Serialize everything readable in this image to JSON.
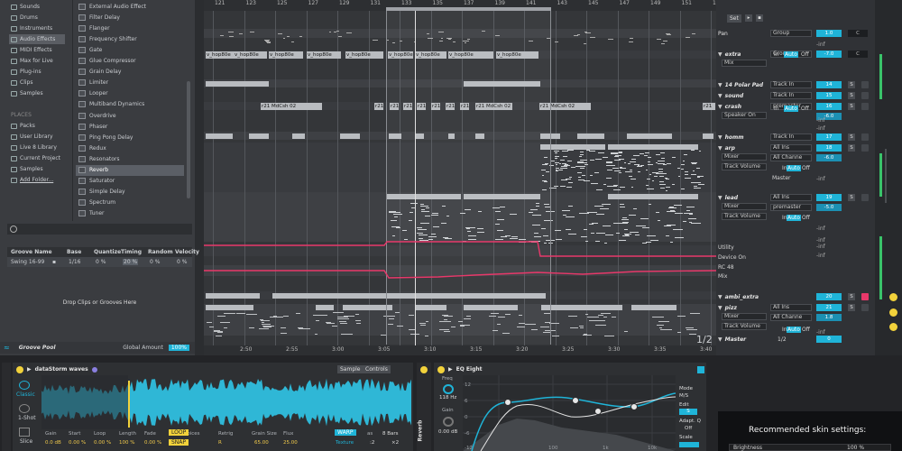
{
  "browser": {
    "categories": [
      "Sounds",
      "Drums",
      "Instruments",
      "Audio Effects",
      "MIDI Effects",
      "Max for Live",
      "Plug-ins",
      "Clips",
      "Samples"
    ],
    "places_label": "PLACES",
    "places": [
      "Packs",
      "User Library",
      "Live 8 Library",
      "Current Project",
      "Samples",
      "Add Folder..."
    ],
    "effects": [
      "External Audio Effect",
      "Filter Delay",
      "Flanger",
      "Frequency Shifter",
      "Gate",
      "Glue Compressor",
      "Grain Delay",
      "Limiter",
      "Looper",
      "Multiband Dynamics",
      "Overdrive",
      "Phaser",
      "Ping Pong Delay",
      "Redux",
      "Resonators",
      "Reverb",
      "Saturator",
      "Simple Delay",
      "Spectrum",
      "Tuner"
    ],
    "selected_effect": "Reverb"
  },
  "groove": {
    "headers": [
      "Groove Name",
      "Base",
      "Quantize",
      "Timing",
      "Random",
      "Velocity"
    ],
    "row": [
      "Swing 16-99",
      "1/16",
      "0 %",
      "20 %",
      "0 %",
      "0 %"
    ],
    "drop_text": "Drop Clips or Grooves Here",
    "pool_label": "Groove Pool",
    "global_amount_label": "Global Amount",
    "global_amount": "100%"
  },
  "ruler": {
    "top": [
      "121",
      "123",
      "125",
      "127",
      "129",
      "131",
      "133",
      "135",
      "137",
      "139",
      "141",
      "143",
      "145",
      "147",
      "149",
      "151",
      "153"
    ],
    "bottom": [
      "2:50",
      "2:55",
      "3:00",
      "3:05",
      "3:10",
      "3:15",
      "3:20",
      "3:25",
      "3:30",
      "3:35",
      "3:40"
    ],
    "page": "1/2"
  },
  "clips": {
    "hop": "v_hop80e",
    "mdcsh": "r21 MdCsh 02",
    "short": "r21"
  },
  "mixer": {
    "set_label": "Set",
    "tracks": [
      {
        "name": "Pan",
        "plain": true,
        "input": "Group",
        "value": "1.0",
        "ch": "C"
      },
      {
        "name": "extra",
        "sub": "Mix",
        "input": "Group",
        "value": "-7.0",
        "ch": "C"
      },
      {
        "name": "14 Polar Pad",
        "input": "Track In",
        "value": "14"
      },
      {
        "name": "sound",
        "input": "Track In",
        "value": "15"
      },
      {
        "name": "crash",
        "sub": "Speaker On",
        "input": "premaster",
        "value": "16",
        "val2": "-6.0"
      },
      {
        "name": "homm",
        "input": "Track In",
        "value": "17"
      },
      {
        "name": "arp",
        "sub": "Mixer",
        "sub2": "Track Volume",
        "input": "All Ins",
        "input2": "All Channe",
        "value": "18",
        "val2": "-6.0"
      },
      {
        "name": "lead",
        "sub": "Mixer",
        "sub2": "Track Volume",
        "input": "All Ins",
        "input2": "premaster",
        "value": "19",
        "val2": "-5.0"
      },
      {
        "name": "ambi_extra",
        "value": "20"
      },
      {
        "name": "pizz",
        "sub": "Mixer",
        "sub2": "Track Volume",
        "input": "All Ins",
        "input2": "All Channe",
        "value": "21",
        "val2": "1.8"
      },
      {
        "name": "Master",
        "value": "0"
      }
    ],
    "labels": {
      "in": "In",
      "auto": "Auto",
      "off": "Off",
      "master": "Master",
      "utility": "Utility",
      "device_on": "Device On",
      "rc48": "RC 48",
      "mix": "Mix",
      "inf": "-inf",
      "s": "S",
      "c": "C",
      "half": "1/2"
    }
  },
  "device1": {
    "title": "dataStorm waves",
    "tabs": [
      "Sample",
      "Controls"
    ],
    "modes": [
      "Classic",
      "1-Shot",
      "Slice"
    ],
    "params": [
      "Gain",
      "Start",
      "Loop",
      "Length",
      "Fade",
      "Voices",
      "Retrig"
    ],
    "values": [
      "0.0 dB",
      "0.00 %",
      "0.00 %",
      "100 %",
      "0.00 %",
      "6",
      "R"
    ],
    "loop_btn": "LOOP",
    "snap_btn": "SNAP",
    "grain_label": "Grain Size",
    "grain": "65.00",
    "flux_label": "Flux",
    "flux": "25.00",
    "warp_btn": "WARP",
    "texture": "Texture",
    "as_label": "as",
    "bars": "8 Bars",
    "half": ":2",
    "double": "×2",
    "side_label": "Reverb"
  },
  "device2": {
    "title": "EQ Eight",
    "freq_label": "Freq",
    "freq": "118 Hz",
    "gain_label": "Gain",
    "gain": "0.00 dB",
    "mode_label": "Mode",
    "mode": "M/S",
    "edit_label": "Edit",
    "edit": "S",
    "adapt_label": "Adapt. Q",
    "adapt": "Off",
    "scale_label": "Scale",
    "grid": [
      "12",
      "6",
      "0",
      "-6",
      "-12",
      "100",
      "1k",
      "10k"
    ]
  },
  "overlay": {
    "title": "Recommended skin settings:",
    "row_label": "Brightness",
    "row_value": "100 %"
  },
  "colors": {
    "accent": "#1fb4d8",
    "waveform": "#2fb7d6",
    "automation": "#e8386a",
    "yellow": "#f2d23b"
  }
}
